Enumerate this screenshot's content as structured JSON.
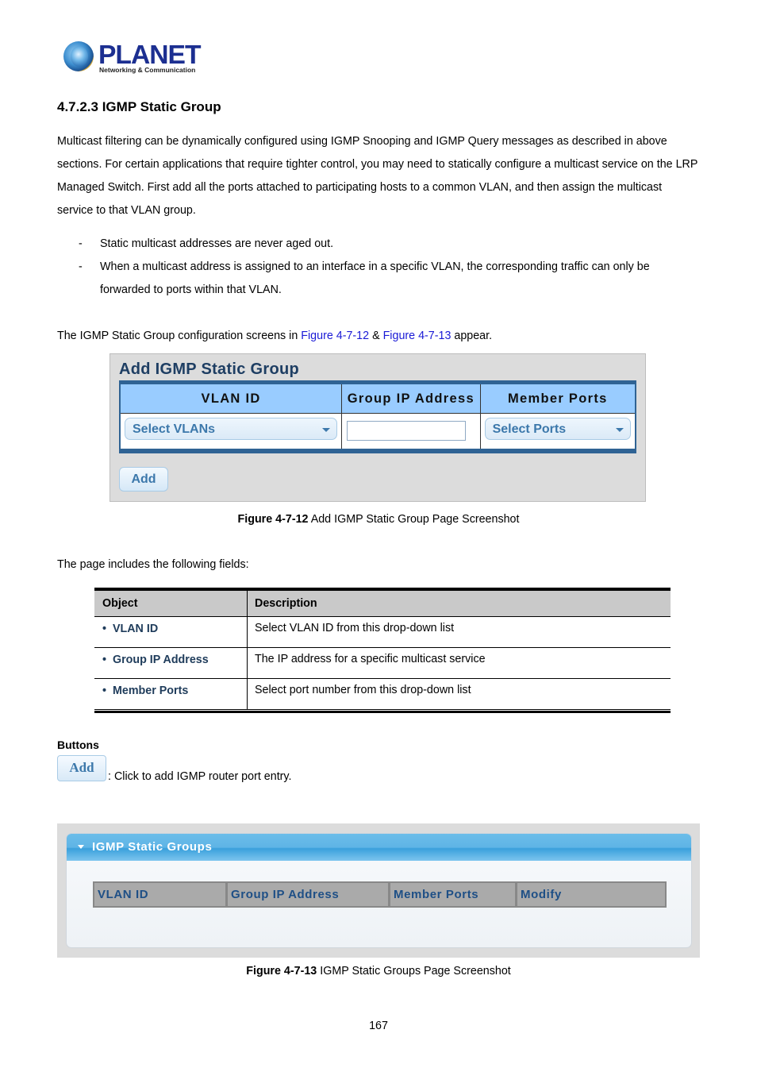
{
  "logo": {
    "brand": "PLANET",
    "tagline": "Networking & Communication"
  },
  "section_title": "4.7.2.3 IGMP Static Group",
  "intro_lines": [
    "Multicast filtering can be dynamically configured using IGMP Snooping and IGMP Query messages as described in above",
    "sections. For certain applications that require tighter control, you may need to statically configure a multicast service on the LRP",
    "Managed Switch. First add all the ports attached to participating hosts to a common VLAN, and then assign the multicast",
    "service to that VLAN group."
  ],
  "bullets": [
    {
      "dash": "-",
      "lines": [
        "Static multicast addresses are never aged out."
      ]
    },
    {
      "dash": "-",
      "lines": [
        "When a multicast address is assigned to an interface in a specific VLAN, the corresponding traffic can only be",
        "forwarded to ports within that VLAN."
      ]
    }
  ],
  "config_sentence": {
    "prefix": "The IGMP Static Group configuration screens in ",
    "link1": "Figure 4-7-12",
    "amp": " & ",
    "link2": "Figure 4-7-13",
    "suffix": " appear."
  },
  "figure1": {
    "title": "Add IGMP Static Group",
    "columns": [
      "VLAN ID",
      "Group IP Address",
      "Member Ports"
    ],
    "vlan_select": "Select VLANs",
    "group_ip_value": "",
    "ports_select": "Select Ports",
    "add_button": "Add",
    "caption_label": "Figure 4-7-12",
    "caption_text": " Add IGMP Static Group Page Screenshot"
  },
  "fields_intro": "The page includes the following fields:",
  "fields_table": {
    "headers": [
      "Object",
      "Description"
    ],
    "rows": [
      {
        "object": "VLAN ID",
        "description": "Select VLAN ID from this drop-down list"
      },
      {
        "object": "Group IP Address",
        "description": "The IP address for a specific multicast service"
      },
      {
        "object": "Member Ports",
        "description": "Select port number from this drop-down list"
      }
    ]
  },
  "buttons_section": {
    "label": "Buttons",
    "add_button": "Add",
    "add_desc": ": Click to add IGMP router port entry."
  },
  "figure2": {
    "panel_title": "IGMP Static Groups",
    "columns": [
      "VLAN ID",
      "Group IP Address",
      "Member Ports",
      "Modify"
    ],
    "caption_label": "Figure 4-7-13",
    "caption_text": " IGMP Static Groups Page Screenshot"
  },
  "page_number": "167"
}
